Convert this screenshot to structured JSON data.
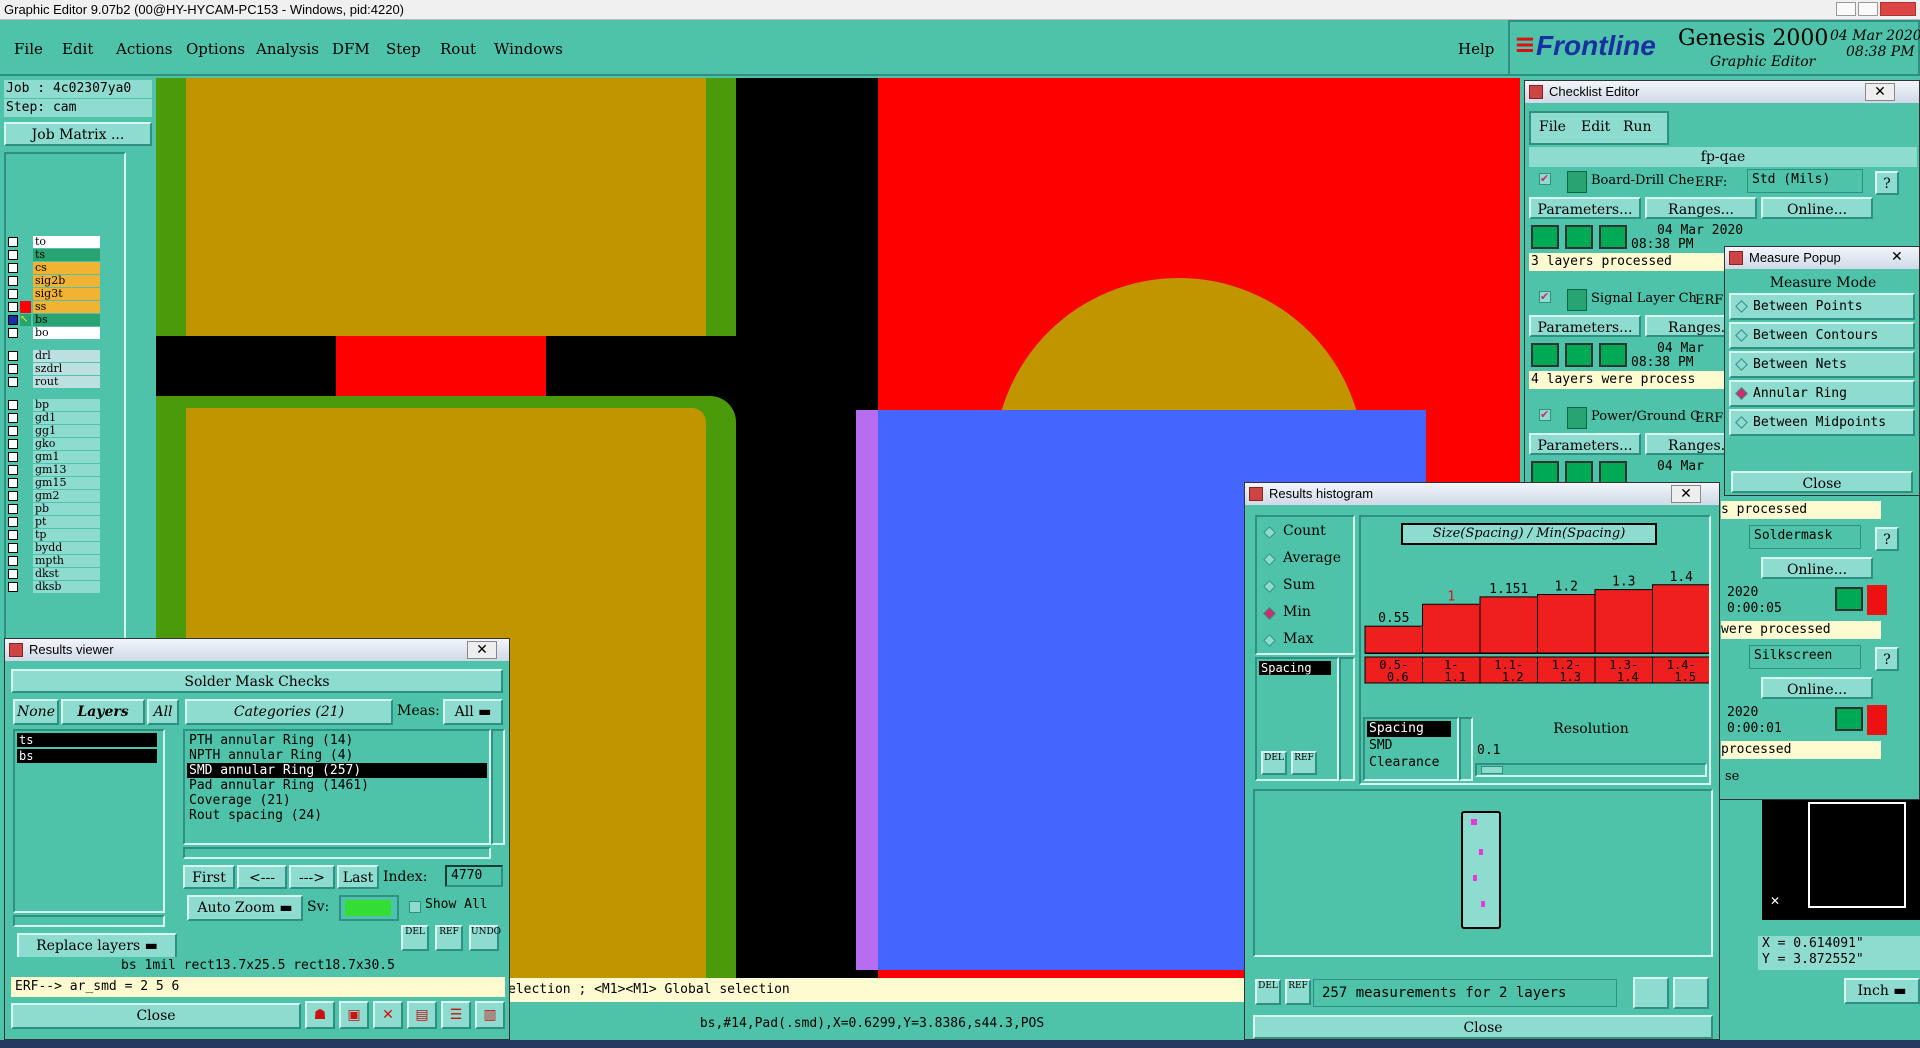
{
  "app": {
    "window_title": "Graphic Editor 9.07b2 (00@HY-HYCAM-PC153 - Windows, pid:4220)",
    "menu": [
      "File",
      "Edit",
      "Actions",
      "Options",
      "Analysis",
      "DFM",
      "Step",
      "Rout",
      "Windows"
    ],
    "help": "Help",
    "brand": "Frontline",
    "product": "Genesis 2000",
    "product_sub": "Graphic Editor",
    "date": "04 Mar 2020",
    "time": "08:38 PM"
  },
  "job": {
    "job_line": "Job : 4c02307ya0",
    "step_line": "Step: cam",
    "job_matrix": "Job Matrix ..."
  },
  "layers_group1": [
    "to",
    "ts",
    "cs",
    "sig2b",
    "sig3t",
    "ss",
    "bs",
    "bo"
  ],
  "layers_group2": [
    "drl",
    "szdrl",
    "rout"
  ],
  "layers_group3": [
    "bp",
    "gd1",
    "gg1",
    "gko",
    "gm1",
    "gm13",
    "gm15",
    "gm2",
    "pb",
    "pt",
    "tp",
    "bydd",
    "mpth",
    "dkst",
    "dksb"
  ],
  "colors": {
    "canvas_bg": "#000000",
    "copper": "#c09500",
    "mask_green": "#4a9a0a",
    "red_layer": "#ff0000",
    "blue_layer": "#4466ff",
    "panel": "#4fc3a9",
    "highlight": "#ff0000"
  },
  "results_viewer": {
    "title": "Results viewer",
    "header": "Solder Mask Checks",
    "none": "None",
    "layers": "Layers",
    "all": "All",
    "categories": "Categories (21)",
    "meas_label": "Meas:",
    "meas_value": "All",
    "layer_items": [
      "ts",
      "bs"
    ],
    "category_items": [
      "PTH annular Ring (14)",
      "NPTH annular Ring (4)",
      "SMD annular Ring (257)",
      "Pad annular Ring (1461)",
      "Coverage (21)",
      "Rout spacing (24)"
    ],
    "first": "First",
    "prev": "<---",
    "next": "--->",
    "last": "Last",
    "index_label": "Index:",
    "index_value": "4770",
    "auto_zoom": "Auto Zoom",
    "sv": "Sv:",
    "show_all": "Show All",
    "replace_layers": "Replace layers",
    "info_line": "bs 1mil  rect13.7x25.5  rect18.7x30.5",
    "erf_line": "ERF--> ar_smd = 2 5 6",
    "close": "Close",
    "del": "DEL",
    "ref": "REF",
    "undo": "UNDO"
  },
  "status": {
    "selection_hint": "election ; <M1><M1> Global selection",
    "feature_info": "bs,#14,Pad(.smd),X=0.6299,Y=3.8386,s44.3,POS"
  },
  "checklist": {
    "title": "Checklist Editor",
    "menu": [
      "File",
      "Edit",
      "Run"
    ],
    "name": "fp-qae",
    "erf_label": "ERF:",
    "erf_value": "Std (Mils)",
    "items": [
      {
        "name": "Board-Drill Che",
        "date": "04 Mar 2020",
        "time": "08:38 PM",
        "msg": "3 layers processed"
      },
      {
        "name": "Signal Layer Ch",
        "date": "04 Mar",
        "time": "08:38 PM",
        "msg": "4 layers were process"
      },
      {
        "name": "Power/Ground C",
        "date": "04 Mar",
        "time": "",
        "msg": ""
      }
    ],
    "parameters": "Parameters...",
    "ranges": "Ranges...",
    "online": "Online...",
    "partial": [
      {
        "msg": "s processed",
        "erf": "Soldermask",
        "year": "2020",
        "elapsed": "0:00:05",
        "msg2": "were processed"
      },
      {
        "erf": "Silkscreen",
        "year": "2020",
        "elapsed": "0:00:01",
        "msg2": "processed"
      }
    ],
    "close_partial": "se"
  },
  "measure": {
    "title": "Measure Popup",
    "mode_label": "Measure Mode",
    "modes": [
      "Between Points",
      "Between Contours",
      "Between Nets",
      "Annular Ring",
      "Between Midpoints"
    ],
    "selected_mode": "Annular Ring",
    "close": "Close",
    "x_readout": "X = 0.614091\"",
    "y_readout": "Y = 3.872552\"",
    "unit": "Inch"
  },
  "histogram": {
    "title": "Results histogram",
    "stats": [
      "Count",
      "Average",
      "Sum",
      "Min",
      "Max"
    ],
    "selected_stat": "Min",
    "list_item": "Spacing",
    "chart_title": "Size(Spacing) / Min(Spacing)",
    "meas_types": [
      "Spacing",
      "SMD",
      "Clearance"
    ],
    "resolution_label": "Resolution",
    "resolution_value": "0.1",
    "footer": "257 measurements for 2 layers",
    "close": "Close"
  },
  "chart_data": {
    "type": "bar",
    "title": "Size(Spacing) / Min(Spacing)",
    "categories": [
      "0.5-0.6",
      "1-1.1",
      "1.1-1.2",
      "1.2-1.3",
      "1.3-1.4",
      "1.4-1.5"
    ],
    "values": [
      0.55,
      1,
      1.151,
      1.2,
      1.3,
      1.4
    ],
    "value_labels": [
      "0.55",
      "1",
      "1.151",
      "1.2",
      "1.3",
      "1.4"
    ],
    "ylim": [
      0,
      1.6
    ]
  }
}
